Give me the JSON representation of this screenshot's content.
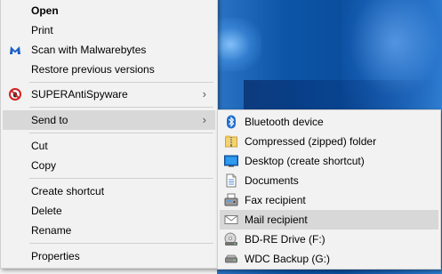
{
  "main_menu": {
    "items": [
      {
        "label": "Open"
      },
      {
        "label": "Print"
      },
      {
        "label": "Scan with Malwarebytes"
      },
      {
        "label": "Restore previous versions"
      },
      {
        "label": "SUPERAntiSpyware"
      },
      {
        "label": "Send to"
      },
      {
        "label": "Cut"
      },
      {
        "label": "Copy"
      },
      {
        "label": "Create shortcut"
      },
      {
        "label": "Delete"
      },
      {
        "label": "Rename"
      },
      {
        "label": "Properties"
      }
    ],
    "submenu_arrow": "›"
  },
  "send_to_menu": {
    "items": [
      {
        "label": "Bluetooth device",
        "icon": "bluetooth-icon"
      },
      {
        "label": "Compressed (zipped) folder",
        "icon": "zip-folder-icon"
      },
      {
        "label": "Desktop (create shortcut)",
        "icon": "desktop-icon"
      },
      {
        "label": "Documents",
        "icon": "documents-icon"
      },
      {
        "label": "Fax recipient",
        "icon": "fax-icon"
      },
      {
        "label": "Mail recipient",
        "icon": "mail-icon"
      },
      {
        "label": "BD-RE Drive (F:)",
        "icon": "optical-drive-icon"
      },
      {
        "label": "WDC Backup (G:)",
        "icon": "drive-icon"
      }
    ]
  },
  "colors": {
    "menu_bg": "#f2f2f2",
    "hover_bg": "#d8d8d8",
    "separator": "#d0d0d0"
  }
}
